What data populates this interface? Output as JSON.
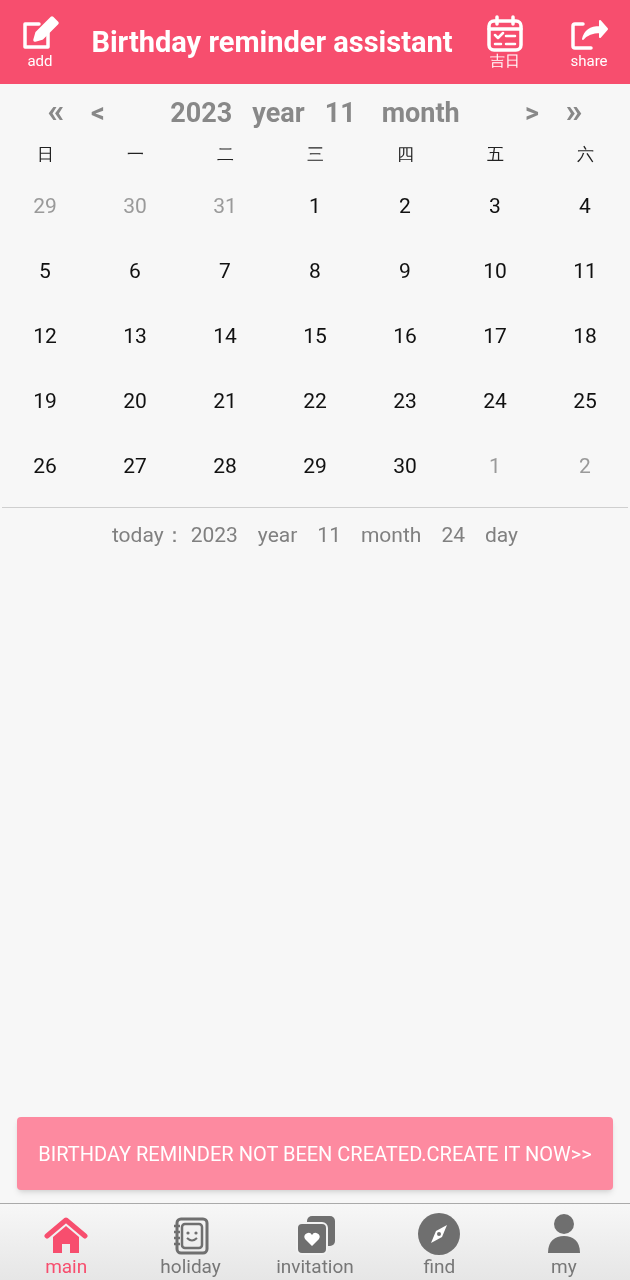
{
  "header": {
    "title": "Birthday reminder assistant",
    "actions": [
      {
        "kind": "add",
        "label": "add"
      },
      {
        "kind": "calendar",
        "label": "吉日"
      },
      {
        "kind": "share",
        "label": "share"
      }
    ]
  },
  "calendar": {
    "nav": {
      "prev_year": "«",
      "prev_month": "<",
      "year": "2023",
      "year_label": "year",
      "month": "11",
      "month_label": "month",
      "next_month": ">",
      "next_year": "»"
    },
    "weekdays": [
      "日",
      "一",
      "二",
      "三",
      "四",
      "五",
      "六"
    ],
    "weeks": [
      [
        {
          "day": "29",
          "in_month": false
        },
        {
          "day": "30",
          "in_month": false
        },
        {
          "day": "31",
          "in_month": false
        },
        {
          "day": "1",
          "in_month": true
        },
        {
          "day": "2",
          "in_month": true
        },
        {
          "day": "3",
          "in_month": true
        },
        {
          "day": "4",
          "in_month": true
        }
      ],
      [
        {
          "day": "5",
          "in_month": true
        },
        {
          "day": "6",
          "in_month": true
        },
        {
          "day": "7",
          "in_month": true
        },
        {
          "day": "8",
          "in_month": true
        },
        {
          "day": "9",
          "in_month": true
        },
        {
          "day": "10",
          "in_month": true
        },
        {
          "day": "11",
          "in_month": true
        }
      ],
      [
        {
          "day": "12",
          "in_month": true
        },
        {
          "day": "13",
          "in_month": true
        },
        {
          "day": "14",
          "in_month": true
        },
        {
          "day": "15",
          "in_month": true
        },
        {
          "day": "16",
          "in_month": true
        },
        {
          "day": "17",
          "in_month": true
        },
        {
          "day": "18",
          "in_month": true
        }
      ],
      [
        {
          "day": "19",
          "in_month": true
        },
        {
          "day": "20",
          "in_month": true
        },
        {
          "day": "21",
          "in_month": true
        },
        {
          "day": "22",
          "in_month": true
        },
        {
          "day": "23",
          "in_month": true
        },
        {
          "day": "24",
          "in_month": true
        },
        {
          "day": "25",
          "in_month": true
        }
      ],
      [
        {
          "day": "26",
          "in_month": true
        },
        {
          "day": "27",
          "in_month": true
        },
        {
          "day": "28",
          "in_month": true
        },
        {
          "day": "29",
          "in_month": true
        },
        {
          "day": "30",
          "in_month": true
        },
        {
          "day": "1",
          "in_month": false
        },
        {
          "day": "2",
          "in_month": false
        }
      ]
    ],
    "today": {
      "label": "today：",
      "year": "2023",
      "year_label": "year",
      "month": "11",
      "month_label": "month",
      "day": "24",
      "day_label": "day"
    }
  },
  "banner": "BIRTHDAY REMINDER NOT BEEN CREATED.CREATE IT NOW>>",
  "tabs": [
    {
      "kind": "home",
      "label": "main",
      "selected": true
    },
    {
      "kind": "book",
      "label": "holiday",
      "selected": false
    },
    {
      "kind": "cards",
      "label": "invitation",
      "selected": false
    },
    {
      "kind": "compass",
      "label": "find",
      "selected": false
    },
    {
      "kind": "user",
      "label": "my",
      "selected": false
    }
  ]
}
